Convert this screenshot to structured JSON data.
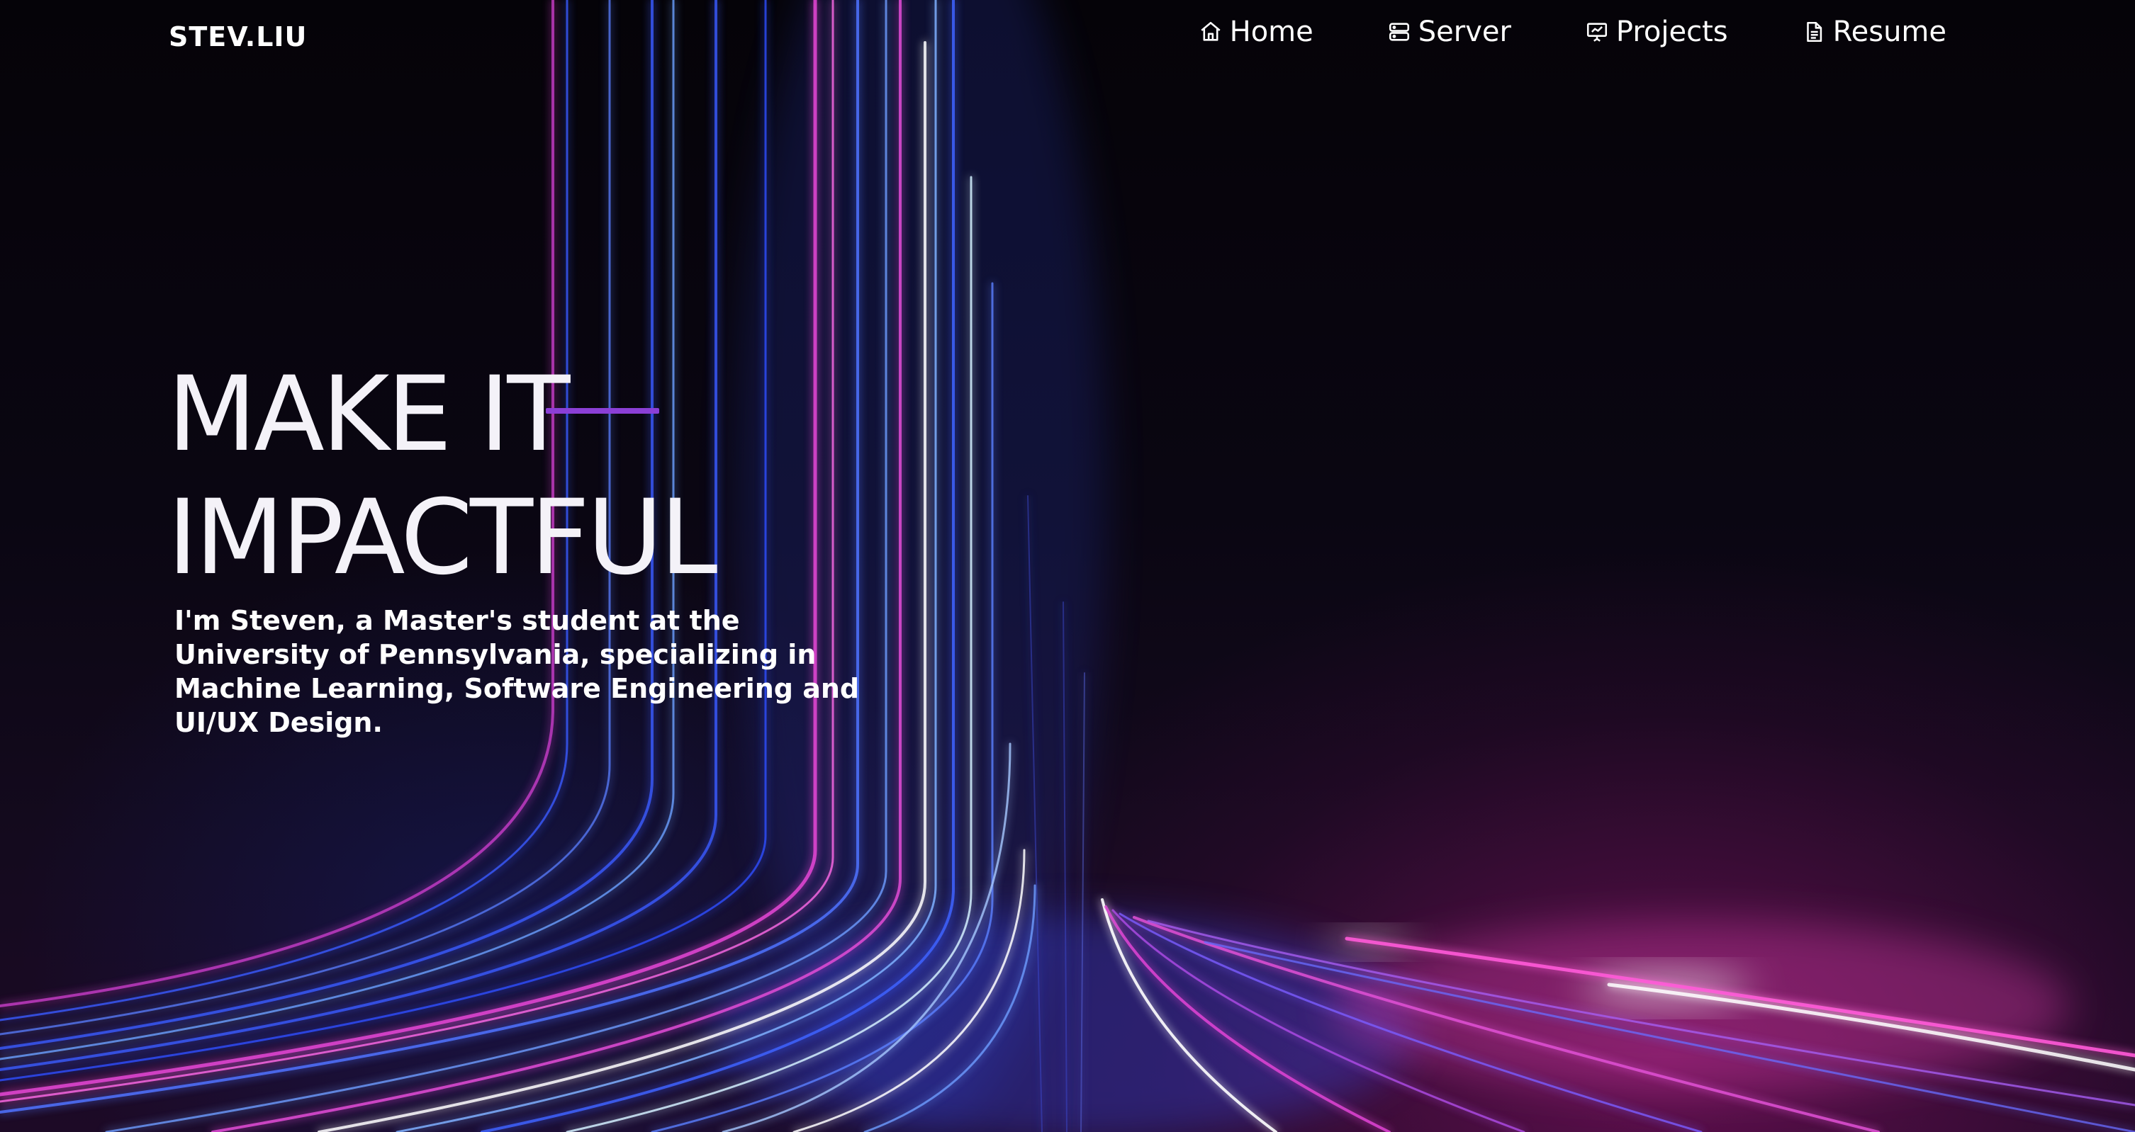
{
  "brand": {
    "logo_text": "STEV.LIU"
  },
  "nav": {
    "items": [
      {
        "label": "Home",
        "icon": "home-icon"
      },
      {
        "label": "Server",
        "icon": "server-icon"
      },
      {
        "label": "Projects",
        "icon": "presentation-chart-icon"
      },
      {
        "label": "Resume",
        "icon": "document-icon"
      }
    ]
  },
  "hero": {
    "line1": "MAKE IT",
    "line2": "IMPACTFUL",
    "subtitle": "I'm Steven, a Master's student at the University of Pennsylvania, specializing in Machine Learning, Software Engineering and UI/UX Design."
  },
  "colors": {
    "background": "#05040a",
    "accent_purple": "#8b3fd6",
    "text": "#ffffff",
    "neon_blue": "#3b6cff",
    "neon_pink": "#e040d0"
  }
}
